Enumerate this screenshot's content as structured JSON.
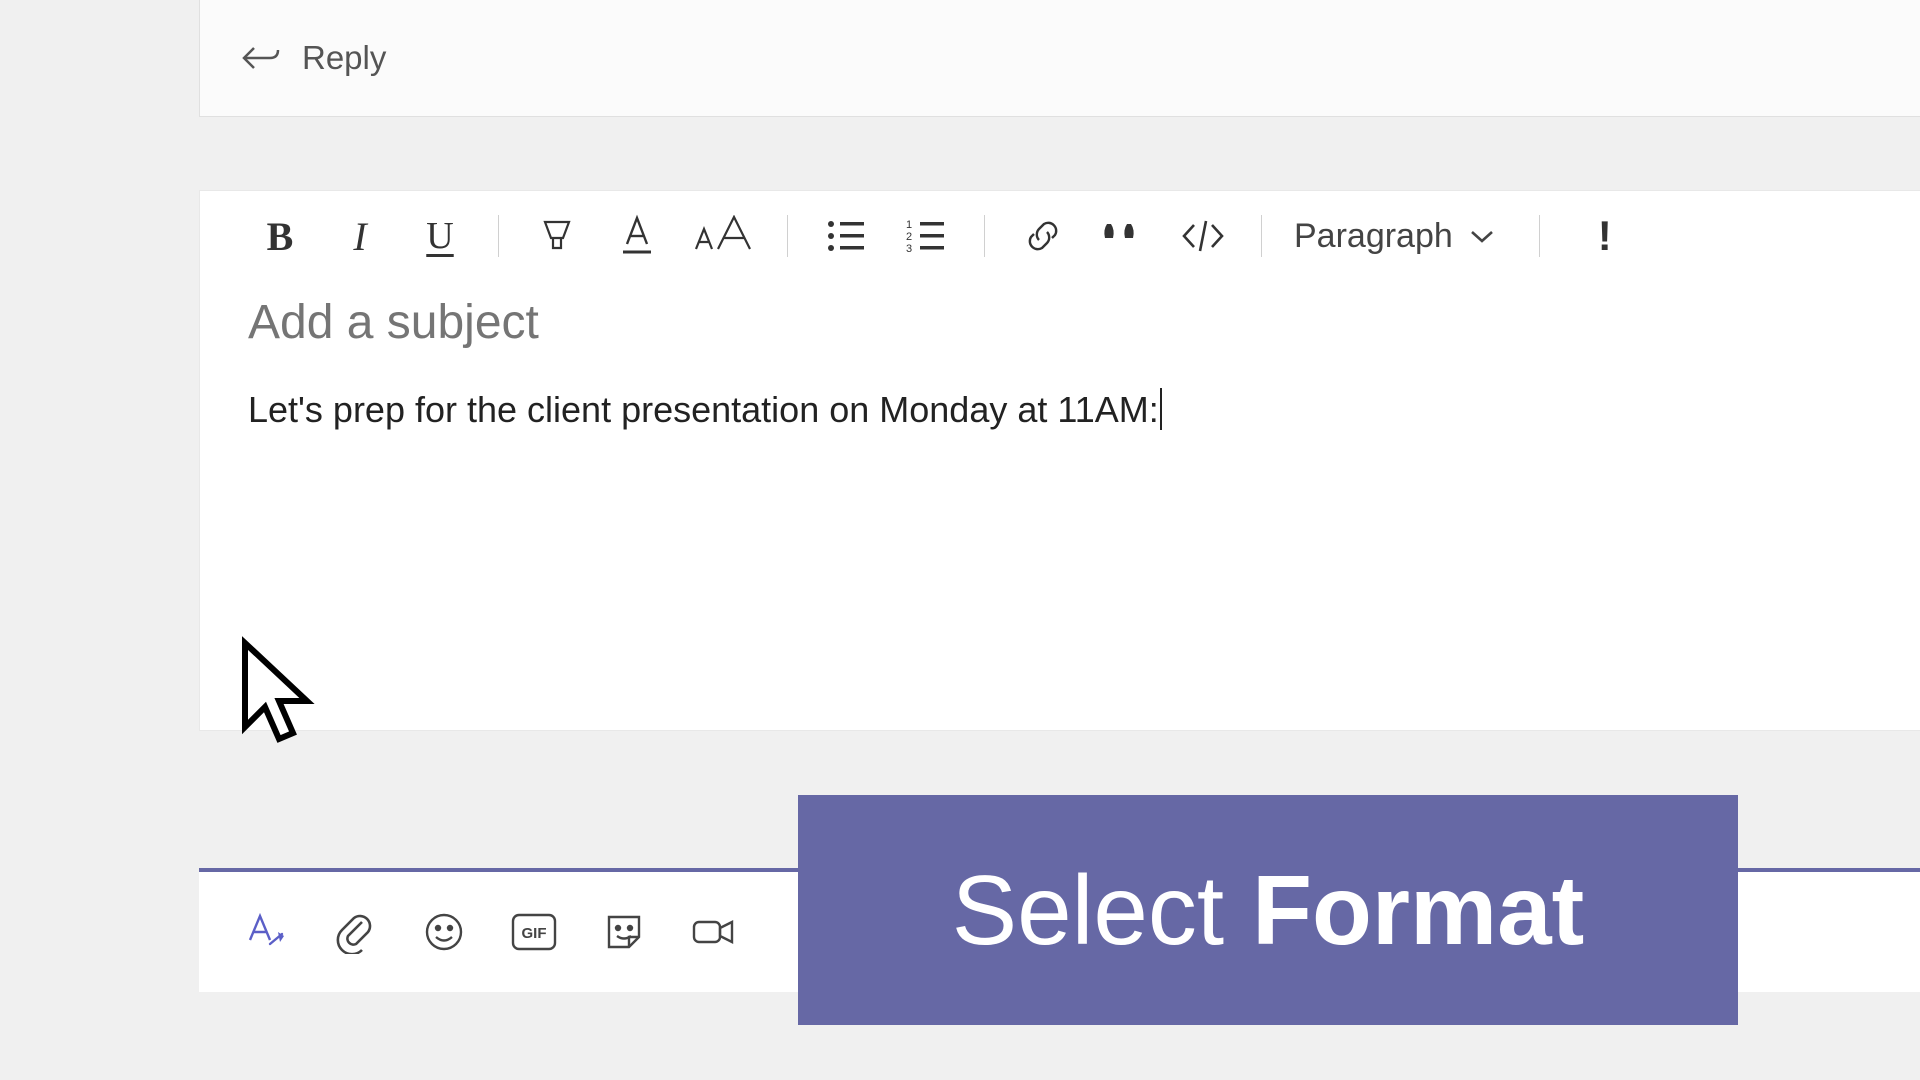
{
  "reply": {
    "label": "Reply"
  },
  "toolbar": {
    "bold": "B",
    "italic": "I",
    "underline": "U",
    "paragraph_label": "Paragraph"
  },
  "compose": {
    "subject_placeholder": "Add a subject",
    "body_text": "Let's prep for the client presentation on Monday at 11AM:"
  },
  "bottom": {
    "gif_label": "GIF"
  },
  "callout": {
    "word1": "Select",
    "word2": "Format"
  }
}
